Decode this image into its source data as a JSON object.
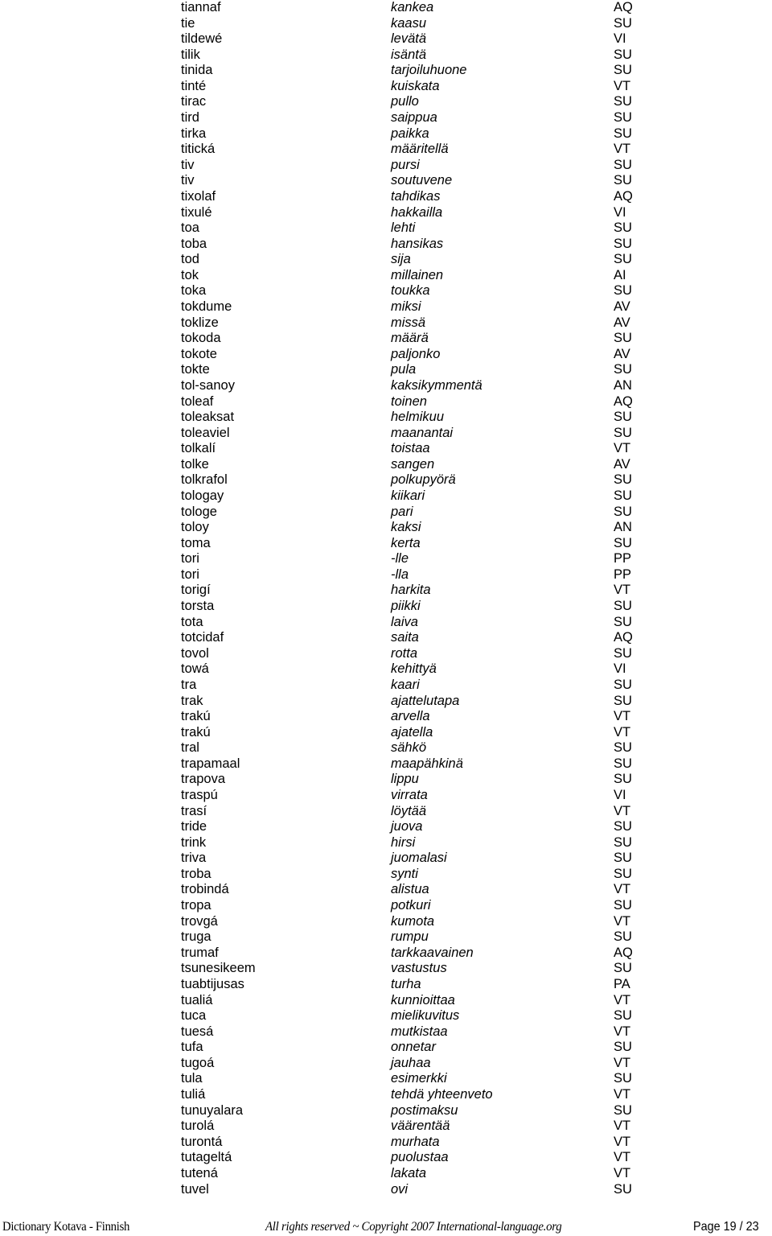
{
  "entries": [
    [
      "tiannaf",
      "kankea",
      "AQ"
    ],
    [
      "tie",
      "kaasu",
      "SU"
    ],
    [
      "tildewé",
      "levätä",
      "VI"
    ],
    [
      "tilik",
      "isäntä",
      "SU"
    ],
    [
      "tinida",
      "tarjoiluhuone",
      "SU"
    ],
    [
      "tinté",
      "kuiskata",
      "VT"
    ],
    [
      "tirac",
      "pullo",
      "SU"
    ],
    [
      "tird",
      "saippua",
      "SU"
    ],
    [
      "tirka",
      "paikka",
      "SU"
    ],
    [
      "titická",
      "määritellä",
      "VT"
    ],
    [
      "tiv",
      "pursi",
      "SU"
    ],
    [
      "tiv",
      "soutuvene",
      "SU"
    ],
    [
      "tixolaf",
      "tahdikas",
      "AQ"
    ],
    [
      "tixulé",
      "hakkailla",
      "VI"
    ],
    [
      "toa",
      "lehti",
      "SU"
    ],
    [
      "toba",
      "hansikas",
      "SU"
    ],
    [
      "tod",
      "sija",
      "SU"
    ],
    [
      "tok",
      "millainen",
      "AI"
    ],
    [
      "toka",
      "toukka",
      "SU"
    ],
    [
      "tokdume",
      "miksi",
      "AV"
    ],
    [
      "toklize",
      "missä",
      "AV"
    ],
    [
      "tokoda",
      "määrä",
      "SU"
    ],
    [
      "tokote",
      "paljonko",
      "AV"
    ],
    [
      "tokte",
      "pula",
      "SU"
    ],
    [
      "tol-sanoy",
      "kaksikymmentä",
      "AN"
    ],
    [
      "toleaf",
      "toinen",
      "AQ"
    ],
    [
      "toleaksat",
      "helmikuu",
      "SU"
    ],
    [
      "toleaviel",
      "maanantai",
      "SU"
    ],
    [
      "tolkalí",
      "toistaa",
      "VT"
    ],
    [
      "tolke",
      "sangen",
      "AV"
    ],
    [
      "tolkrafol",
      "polkupyörä",
      "SU"
    ],
    [
      "tologay",
      "kiikari",
      "SU"
    ],
    [
      "tologe",
      "pari",
      "SU"
    ],
    [
      "toloy",
      "kaksi",
      "AN"
    ],
    [
      "toma",
      "kerta",
      "SU"
    ],
    [
      "tori",
      "-lle",
      "PP"
    ],
    [
      "tori",
      "-lla",
      "PP"
    ],
    [
      "torigí",
      "harkita",
      "VT"
    ],
    [
      "torsta",
      "piikki",
      "SU"
    ],
    [
      "tota",
      "laiva",
      "SU"
    ],
    [
      "totcidaf",
      "saita",
      "AQ"
    ],
    [
      "tovol",
      "rotta",
      "SU"
    ],
    [
      "towá",
      "kehittyä",
      "VI"
    ],
    [
      "tra",
      "kaari",
      "SU"
    ],
    [
      "trak",
      "ajattelutapa",
      "SU"
    ],
    [
      "trakú",
      "arvella",
      "VT"
    ],
    [
      "trakú",
      "ajatella",
      "VT"
    ],
    [
      "tral",
      "sähkö",
      "SU"
    ],
    [
      "trapamaal",
      "maapähkinä",
      "SU"
    ],
    [
      "trapova",
      "lippu",
      "SU"
    ],
    [
      "traspú",
      "virrata",
      "VI"
    ],
    [
      "trasí",
      "löytää",
      "VT"
    ],
    [
      "tride",
      "juova",
      "SU"
    ],
    [
      "trink",
      "hirsi",
      "SU"
    ],
    [
      "triva",
      "juomalasi",
      "SU"
    ],
    [
      "troba",
      "synti",
      "SU"
    ],
    [
      "trobindá",
      "alistua",
      "VT"
    ],
    [
      "tropa",
      "potkuri",
      "SU"
    ],
    [
      "trovgá",
      "kumota",
      "VT"
    ],
    [
      "truga",
      "rumpu",
      "SU"
    ],
    [
      "trumaf",
      "tarkkaavainen",
      "AQ"
    ],
    [
      "tsunesikeem",
      "vastustus",
      "SU"
    ],
    [
      "tuabtijusas",
      "turha",
      "PA"
    ],
    [
      "tualiá",
      "kunnioittaa",
      "VT"
    ],
    [
      "tuca",
      "mielikuvitus",
      "SU"
    ],
    [
      "tuesá",
      "mutkistaa",
      "VT"
    ],
    [
      "tufa",
      "onnetar",
      "SU"
    ],
    [
      "tugoá",
      "jauhaa",
      "VT"
    ],
    [
      "tula",
      "esimerkki",
      "SU"
    ],
    [
      "tuliá",
      "tehdä yhteenveto",
      "VT"
    ],
    [
      "tunuyalara",
      "postimaksu",
      "SU"
    ],
    [
      "turolá",
      "väärentää",
      "VT"
    ],
    [
      "turontá",
      "murhata",
      "VT"
    ],
    [
      "tutageltá",
      "puolustaa",
      "VT"
    ],
    [
      "tutená",
      "lakata",
      "VT"
    ],
    [
      "tuvel",
      "ovi",
      "SU"
    ]
  ],
  "footer": {
    "left": "Dictionary Kotava - Finnish",
    "center": "All rights reserved ~ Copyright 2007 International-language.org",
    "page": "Page 19 / 23"
  }
}
